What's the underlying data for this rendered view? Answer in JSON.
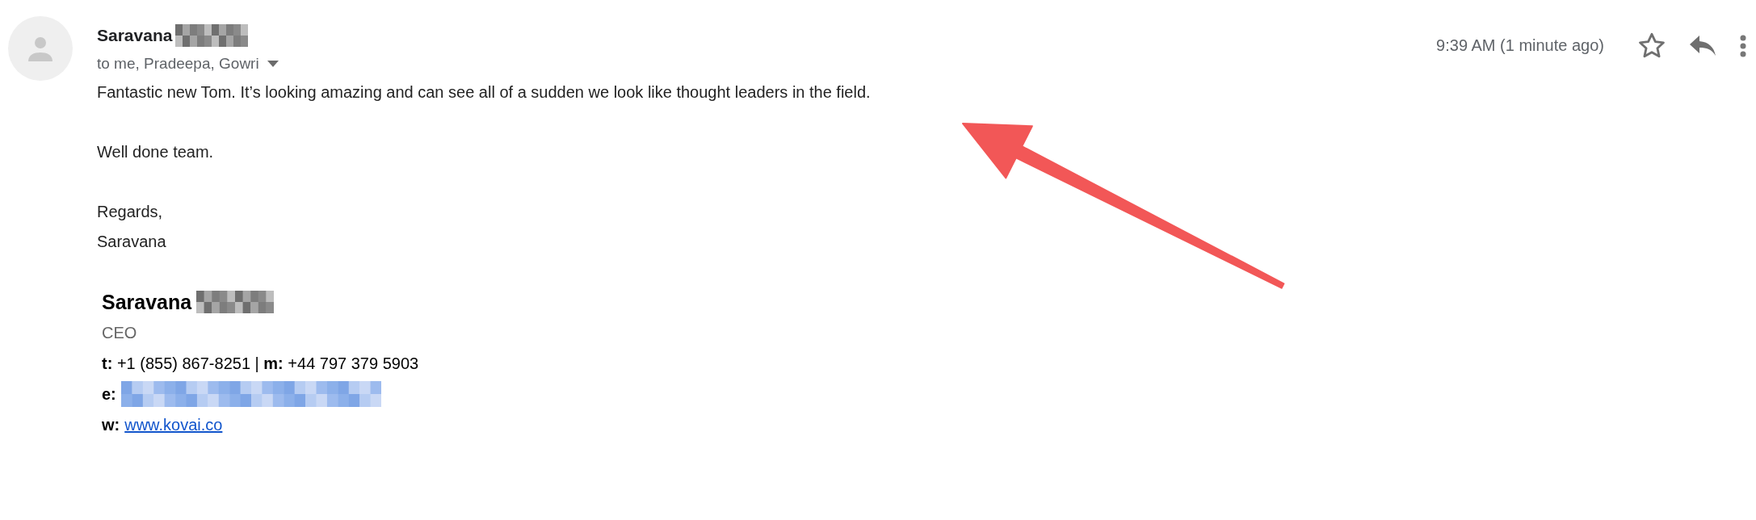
{
  "message": {
    "sender": "Saravana",
    "recipients": "to me, Pradeepa, Gowri",
    "time": "9:39 AM (1 minute ago)",
    "starred": false
  },
  "body": [
    {
      "lines": [
        "Fantastic new Tom. It’s looking amazing and can see all of a sudden we look like thought leaders in the field."
      ]
    },
    {
      "lines": [
        "Well done team."
      ]
    },
    {
      "lines": [
        "Regards,",
        "Saravana"
      ]
    }
  ],
  "signature": {
    "name": "Saravana",
    "title": "CEO",
    "phone": "**t:** +1 (855) 867-8251 | **m:** +44 797 379 5903",
    "email_label": "e:",
    "web_label": "w:",
    "website": "www.kovai.co"
  }
}
